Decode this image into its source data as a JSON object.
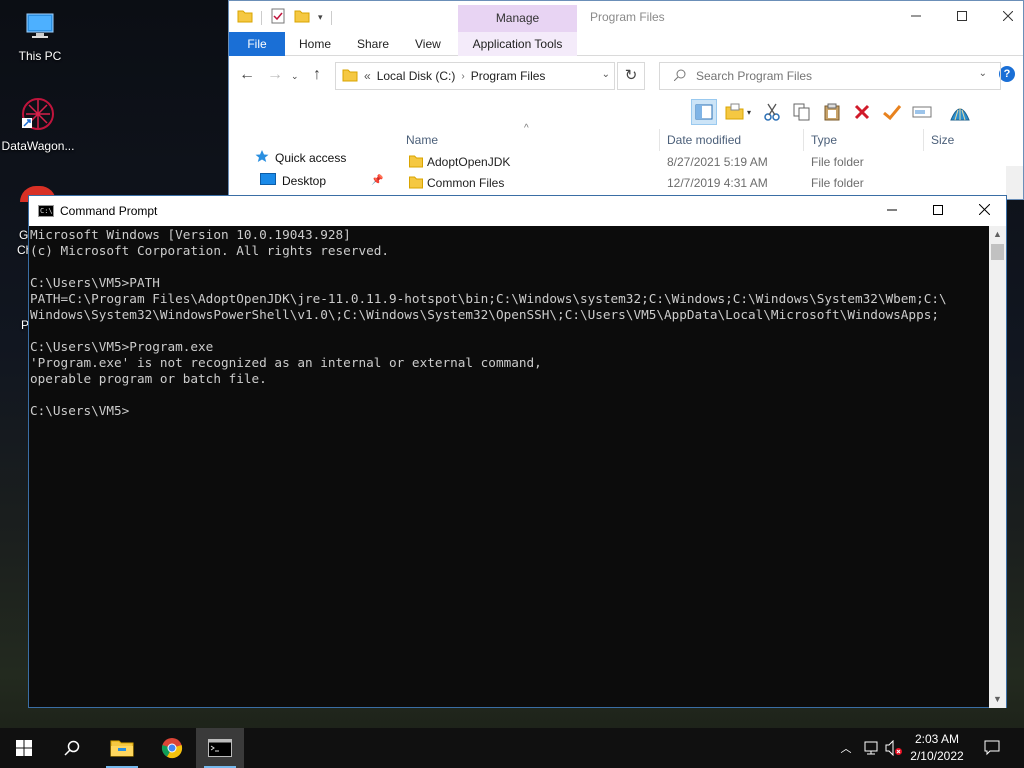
{
  "desktop": {
    "icons": [
      {
        "label": "This PC"
      },
      {
        "label": "DataWagon..."
      }
    ],
    "peek_labels": [
      "G",
      "Ch",
      "P"
    ]
  },
  "explorer": {
    "title": "Program Files",
    "manage_label": "Manage",
    "ribbon_tabs": [
      "File",
      "Home",
      "Share",
      "View",
      "Application Tools"
    ],
    "address": {
      "root": "Local Disk (C:)",
      "folder": "Program Files"
    },
    "search_placeholder": "Search Program Files",
    "nav_items": [
      {
        "label": "Quick access"
      },
      {
        "label": "Desktop"
      }
    ],
    "columns": [
      "Name",
      "Date modified",
      "Type",
      "Size"
    ],
    "files": [
      {
        "name": "AdoptOpenJDK",
        "date": "8/27/2021 5:19 AM",
        "type": "File folder"
      },
      {
        "name": "Common Files",
        "date": "12/7/2019 4:31 AM",
        "type": "File folder"
      }
    ]
  },
  "cmd": {
    "title": "Command Prompt",
    "icon_text": "C:\\",
    "lines": [
      "Microsoft Windows [Version 10.0.19043.928]",
      "(c) Microsoft Corporation. All rights reserved.",
      "",
      "C:\\Users\\VM5>PATH",
      "PATH=C:\\Program Files\\AdoptOpenJDK\\jre-11.0.11.9-hotspot\\bin;C:\\Windows\\system32;C:\\Windows;C:\\Windows\\System32\\Wbem;C:\\",
      "Windows\\System32\\WindowsPowerShell\\v1.0\\;C:\\Windows\\System32\\OpenSSH\\;C:\\Users\\VM5\\AppData\\Local\\Microsoft\\WindowsApps;",
      "",
      "C:\\Users\\VM5>Program.exe",
      "'Program.exe' is not recognized as an internal or external command,",
      "operable program or batch file.",
      "",
      "C:\\Users\\VM5>"
    ]
  },
  "taskbar": {
    "time": "2:03 AM",
    "date": "2/10/2022"
  },
  "colors": {
    "accent": "#1a6fd6",
    "manage_tab": "#e8d4f3",
    "console_bg": "#0c0c0c",
    "console_fg": "#cccccc",
    "taskbar": "#101010"
  }
}
